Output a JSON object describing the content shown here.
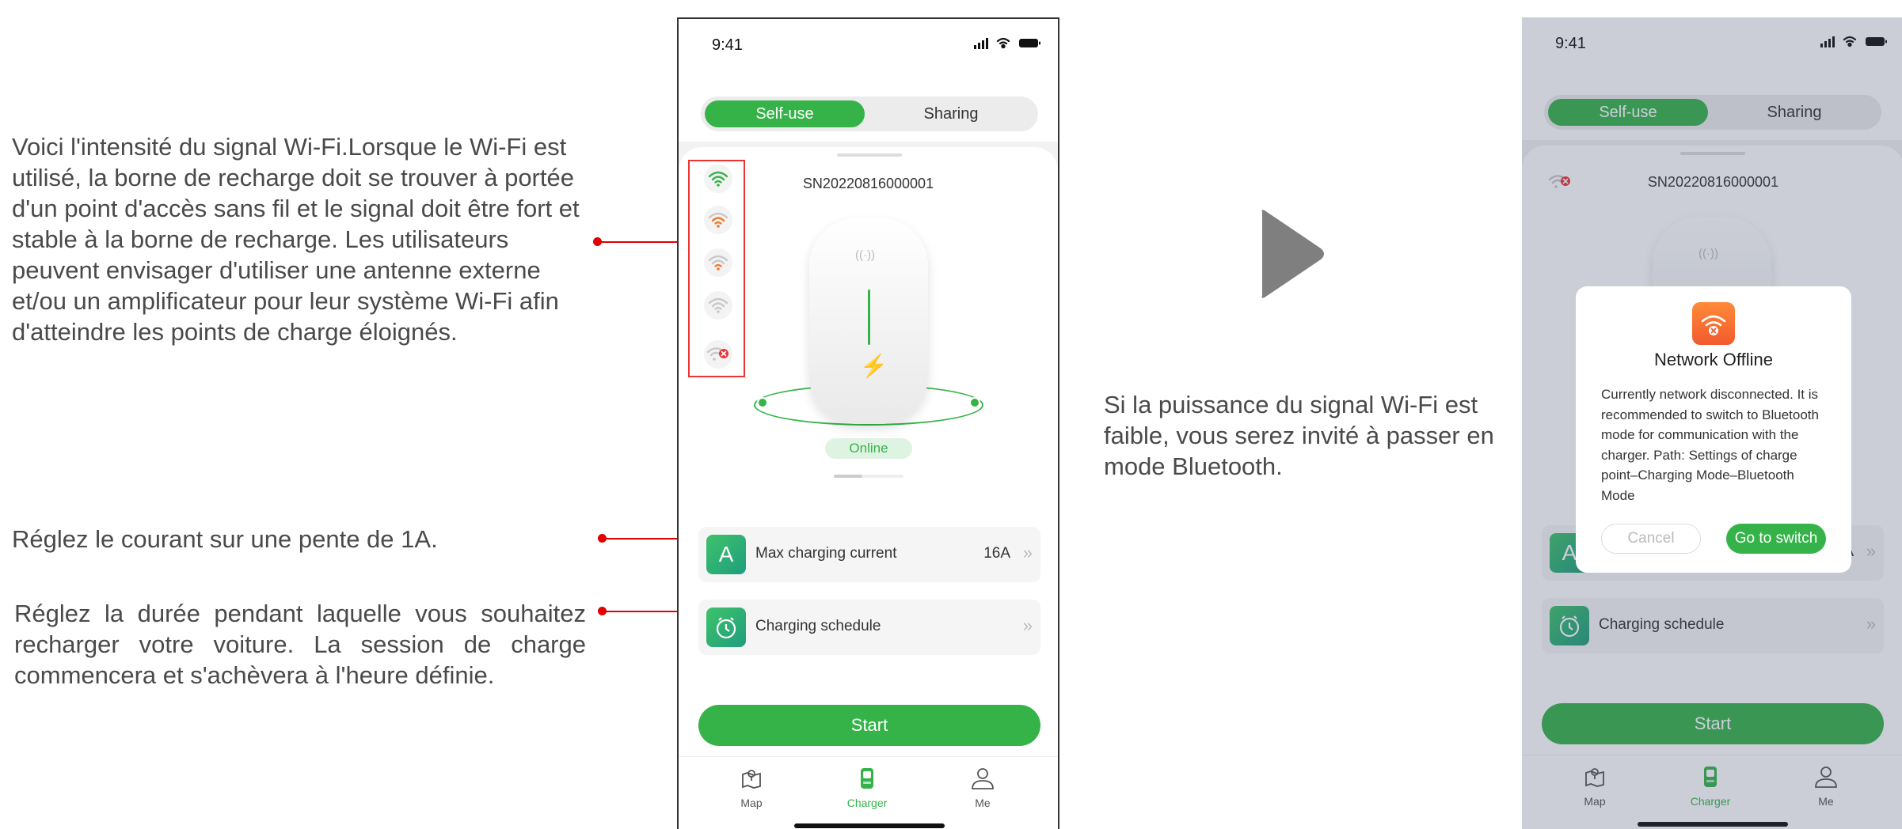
{
  "annotations": {
    "wifi": "Voici l'intensité du signal Wi-Fi.Lorsque le Wi-Fi est utilisé, la borne de recharge doit se trouver à portée d'un point d'accès sans fil et le signal doit être fort et stable à la borne de recharge. Les utilisateurs peuvent envisager d'utiliser une antenne externe et/ou un amplificateur pour leur système Wi-Fi afin d'atteindre les points de charge éloignés.",
    "current": "Réglez le courant sur une pente de 1A.",
    "schedule": "Réglez la durée pendant laquelle vous souhaitez recharger votre voiture. La session de charge commencera et s'achèvera à l'heure définie.",
    "bluetooth": "Si la puissance du signal Wi-Fi est faible, vous serez invité à passer en mode Bluetooth."
  },
  "phone": {
    "time": "9:41",
    "tabs": {
      "self_use": "Self-use",
      "sharing": "Sharing",
      "active": "self_use"
    },
    "serial": "SN20220816000001",
    "status": "Online",
    "wifi_levels": [
      {
        "level": "strong",
        "color": "#35b348"
      },
      {
        "level": "medium",
        "color": "#f07a2a"
      },
      {
        "level": "weak",
        "color": "#f07a2a"
      },
      {
        "level": "none",
        "color": "#b5b5b5"
      },
      {
        "level": "offline",
        "color": "#b5b5b5"
      }
    ],
    "max_current": {
      "label": "Max charging current",
      "value": "16A",
      "icon_letter": "A"
    },
    "schedule": {
      "label": "Charging schedule"
    },
    "start": "Start",
    "bottom_nav": [
      {
        "label": "Map",
        "icon": "map-icon"
      },
      {
        "label": "Charger",
        "icon": "charger-icon",
        "active": true
      },
      {
        "label": "Me",
        "icon": "person-icon"
      }
    ]
  },
  "dialog": {
    "title": "Network Offline",
    "body": "Currently network disconnected. It is recommended to switch to Bluetooth mode for communication with the charger. Path: Settings of charge point–Charging Mode–Bluetooth Mode",
    "cancel": "Cancel",
    "confirm": "Go to switch"
  },
  "colors": {
    "accent": "#35b348",
    "annotation": "#e00000",
    "warning": "#f25a2c"
  }
}
